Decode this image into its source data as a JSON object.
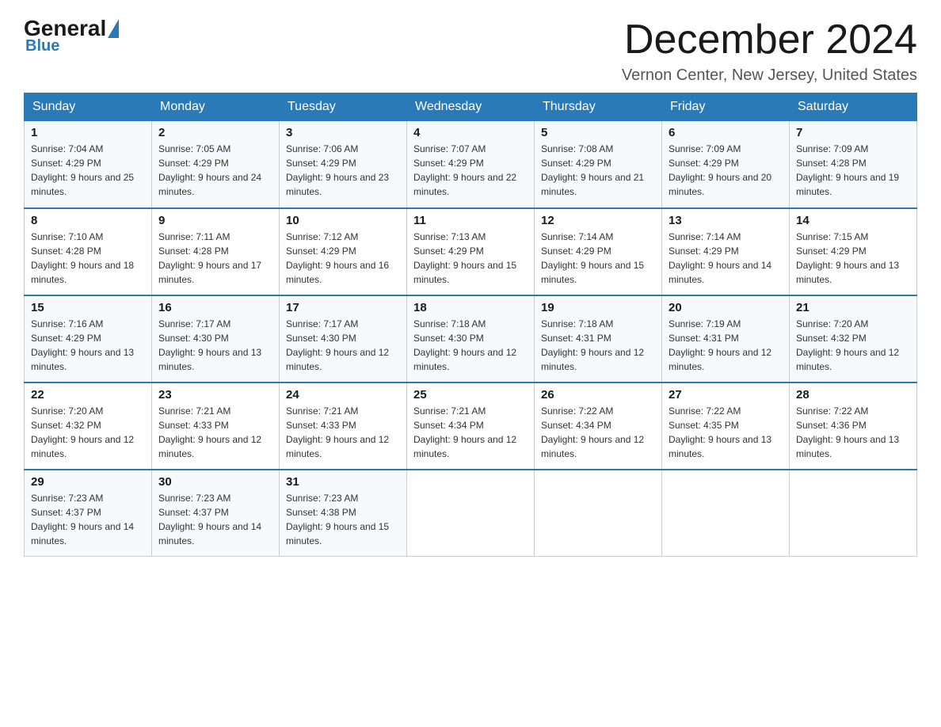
{
  "header": {
    "logo_general": "General",
    "logo_blue": "Blue",
    "month_title": "December 2024",
    "location": "Vernon Center, New Jersey, United States"
  },
  "days_of_week": [
    "Sunday",
    "Monday",
    "Tuesday",
    "Wednesday",
    "Thursday",
    "Friday",
    "Saturday"
  ],
  "weeks": [
    [
      {
        "day": "1",
        "sunrise": "7:04 AM",
        "sunset": "4:29 PM",
        "daylight": "9 hours and 25 minutes."
      },
      {
        "day": "2",
        "sunrise": "7:05 AM",
        "sunset": "4:29 PM",
        "daylight": "9 hours and 24 minutes."
      },
      {
        "day": "3",
        "sunrise": "7:06 AM",
        "sunset": "4:29 PM",
        "daylight": "9 hours and 23 minutes."
      },
      {
        "day": "4",
        "sunrise": "7:07 AM",
        "sunset": "4:29 PM",
        "daylight": "9 hours and 22 minutes."
      },
      {
        "day": "5",
        "sunrise": "7:08 AM",
        "sunset": "4:29 PM",
        "daylight": "9 hours and 21 minutes."
      },
      {
        "day": "6",
        "sunrise": "7:09 AM",
        "sunset": "4:29 PM",
        "daylight": "9 hours and 20 minutes."
      },
      {
        "day": "7",
        "sunrise": "7:09 AM",
        "sunset": "4:28 PM",
        "daylight": "9 hours and 19 minutes."
      }
    ],
    [
      {
        "day": "8",
        "sunrise": "7:10 AM",
        "sunset": "4:28 PM",
        "daylight": "9 hours and 18 minutes."
      },
      {
        "day": "9",
        "sunrise": "7:11 AM",
        "sunset": "4:28 PM",
        "daylight": "9 hours and 17 minutes."
      },
      {
        "day": "10",
        "sunrise": "7:12 AM",
        "sunset": "4:29 PM",
        "daylight": "9 hours and 16 minutes."
      },
      {
        "day": "11",
        "sunrise": "7:13 AM",
        "sunset": "4:29 PM",
        "daylight": "9 hours and 15 minutes."
      },
      {
        "day": "12",
        "sunrise": "7:14 AM",
        "sunset": "4:29 PM",
        "daylight": "9 hours and 15 minutes."
      },
      {
        "day": "13",
        "sunrise": "7:14 AM",
        "sunset": "4:29 PM",
        "daylight": "9 hours and 14 minutes."
      },
      {
        "day": "14",
        "sunrise": "7:15 AM",
        "sunset": "4:29 PM",
        "daylight": "9 hours and 13 minutes."
      }
    ],
    [
      {
        "day": "15",
        "sunrise": "7:16 AM",
        "sunset": "4:29 PM",
        "daylight": "9 hours and 13 minutes."
      },
      {
        "day": "16",
        "sunrise": "7:17 AM",
        "sunset": "4:30 PM",
        "daylight": "9 hours and 13 minutes."
      },
      {
        "day": "17",
        "sunrise": "7:17 AM",
        "sunset": "4:30 PM",
        "daylight": "9 hours and 12 minutes."
      },
      {
        "day": "18",
        "sunrise": "7:18 AM",
        "sunset": "4:30 PM",
        "daylight": "9 hours and 12 minutes."
      },
      {
        "day": "19",
        "sunrise": "7:18 AM",
        "sunset": "4:31 PM",
        "daylight": "9 hours and 12 minutes."
      },
      {
        "day": "20",
        "sunrise": "7:19 AM",
        "sunset": "4:31 PM",
        "daylight": "9 hours and 12 minutes."
      },
      {
        "day": "21",
        "sunrise": "7:20 AM",
        "sunset": "4:32 PM",
        "daylight": "9 hours and 12 minutes."
      }
    ],
    [
      {
        "day": "22",
        "sunrise": "7:20 AM",
        "sunset": "4:32 PM",
        "daylight": "9 hours and 12 minutes."
      },
      {
        "day": "23",
        "sunrise": "7:21 AM",
        "sunset": "4:33 PM",
        "daylight": "9 hours and 12 minutes."
      },
      {
        "day": "24",
        "sunrise": "7:21 AM",
        "sunset": "4:33 PM",
        "daylight": "9 hours and 12 minutes."
      },
      {
        "day": "25",
        "sunrise": "7:21 AM",
        "sunset": "4:34 PM",
        "daylight": "9 hours and 12 minutes."
      },
      {
        "day": "26",
        "sunrise": "7:22 AM",
        "sunset": "4:34 PM",
        "daylight": "9 hours and 12 minutes."
      },
      {
        "day": "27",
        "sunrise": "7:22 AM",
        "sunset": "4:35 PM",
        "daylight": "9 hours and 13 minutes."
      },
      {
        "day": "28",
        "sunrise": "7:22 AM",
        "sunset": "4:36 PM",
        "daylight": "9 hours and 13 minutes."
      }
    ],
    [
      {
        "day": "29",
        "sunrise": "7:23 AM",
        "sunset": "4:37 PM",
        "daylight": "9 hours and 14 minutes."
      },
      {
        "day": "30",
        "sunrise": "7:23 AM",
        "sunset": "4:37 PM",
        "daylight": "9 hours and 14 minutes."
      },
      {
        "day": "31",
        "sunrise": "7:23 AM",
        "sunset": "4:38 PM",
        "daylight": "9 hours and 15 minutes."
      },
      null,
      null,
      null,
      null
    ]
  ]
}
